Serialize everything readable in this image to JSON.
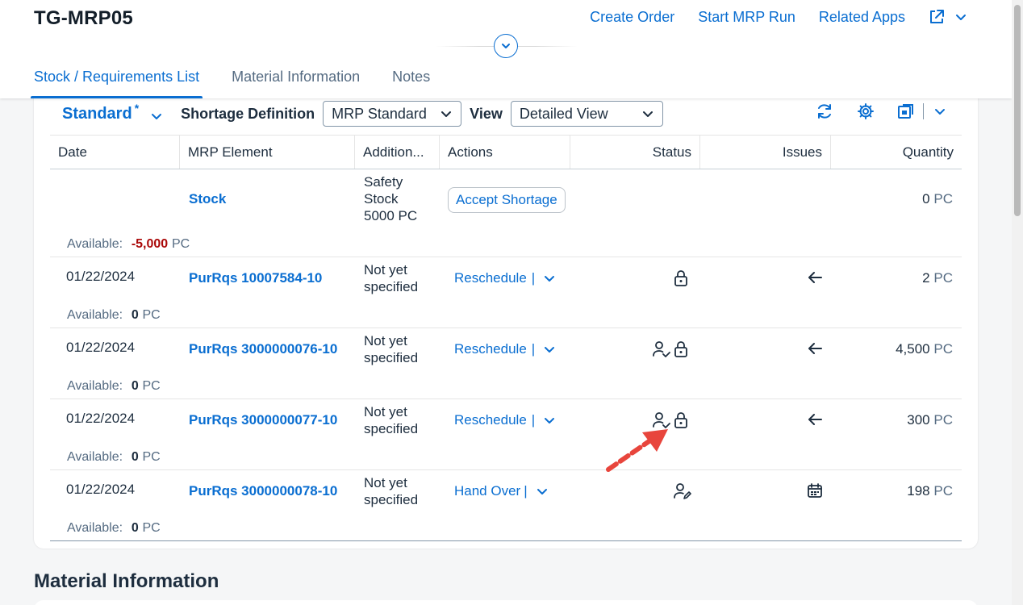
{
  "header": {
    "title": "TG-MRP05",
    "actions": [
      "Create Order",
      "Start MRP Run",
      "Related Apps"
    ],
    "tabs": [
      "Stock / Requirements List",
      "Material Information",
      "Notes"
    ]
  },
  "toolbar": {
    "variant": "Standard",
    "variant_modified": "*",
    "shortage_label": "Shortage Definition",
    "shortage_value": "MRP Standard",
    "view_label": "View",
    "view_value": "Detailed View"
  },
  "table": {
    "columns": [
      "Date",
      "MRP Element",
      "Addition...",
      "Actions",
      "Status",
      "Issues",
      "Quantity"
    ],
    "stock_row": {
      "element": "Stock",
      "additional": [
        "Safety",
        "Stock",
        "5000 PC"
      ],
      "action": "Accept Shortage",
      "quantity": "0",
      "unit": "PC",
      "available_label": "Available:",
      "available_value": "-5,000",
      "available_unit": "PC"
    },
    "rows": [
      {
        "date": "01/22/2024",
        "element": "PurRqs 10007584-10",
        "additional": [
          "Not yet",
          "specified"
        ],
        "action": "Reschedule",
        "pipe": "|",
        "status_icons": [
          "lock-icon"
        ],
        "issue_icon": "arrow-left-icon",
        "quantity": "2",
        "unit": "PC",
        "available_label": "Available:",
        "available_value": "0",
        "available_unit": "PC"
      },
      {
        "date": "01/22/2024",
        "element": "PurRqs 3000000076-10",
        "additional": [
          "Not yet",
          "specified"
        ],
        "action": "Reschedule",
        "pipe": "|",
        "status_icons": [
          "user-check-icon",
          "lock-icon"
        ],
        "issue_icon": "arrow-left-icon",
        "quantity": "4,500",
        "unit": "PC",
        "available_label": "Available:",
        "available_value": "0",
        "available_unit": "PC"
      },
      {
        "date": "01/22/2024",
        "element": "PurRqs 3000000077-10",
        "additional": [
          "Not yet",
          "specified"
        ],
        "action": "Reschedule",
        "pipe": "|",
        "status_icons": [
          "user-check-icon",
          "lock-icon"
        ],
        "issue_icon": "arrow-left-icon",
        "quantity": "300",
        "unit": "PC",
        "available_label": "Available:",
        "available_value": "0",
        "available_unit": "PC"
      },
      {
        "date": "01/22/2024",
        "element": "PurRqs 3000000078-10",
        "additional": [
          "Not yet",
          "specified"
        ],
        "action": "Hand Over",
        "pipe": "|",
        "status_icons": [
          "user-edit-icon"
        ],
        "issue_icon": "calendar-icon",
        "quantity": "198",
        "unit": "PC",
        "available_label": "Available:",
        "available_value": "0",
        "available_unit": "PC"
      }
    ]
  },
  "sections": {
    "material_information_title": "Material Information"
  },
  "colors": {
    "link": "#0a6ed1",
    "negative": "#aa0808",
    "annotation_arrow": "#e8453c"
  }
}
